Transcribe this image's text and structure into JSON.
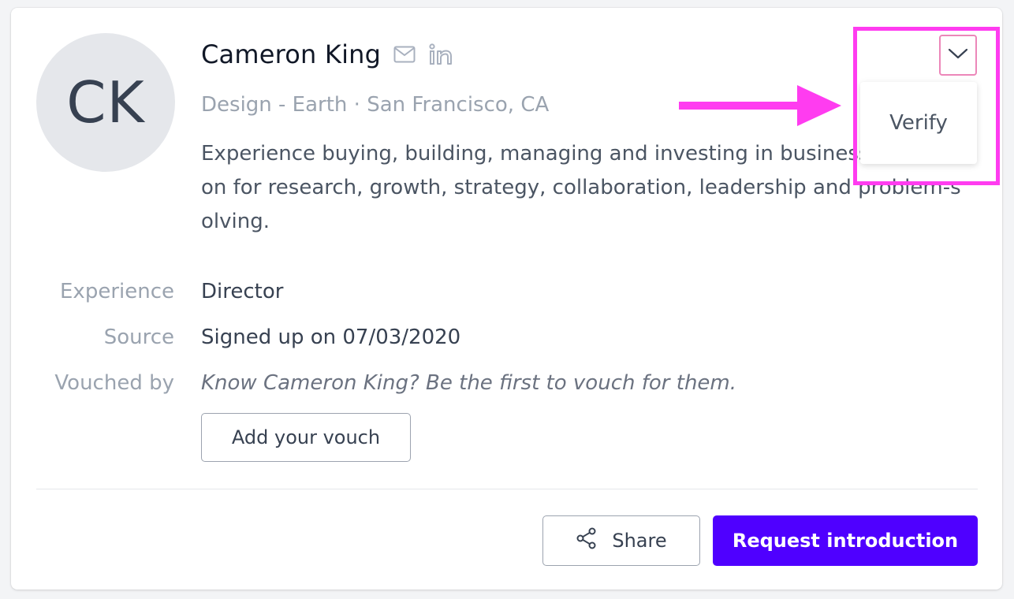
{
  "profile": {
    "initials": "CK",
    "name": "Cameron King",
    "subtitle": "Design - Earth · San Francisco, CA",
    "bio": "Experience buying, building, managing and investing in businesses. Passion for research, growth, strategy, collaboration, leadership and problem-solving."
  },
  "icons": {
    "email": "mail-icon",
    "linkedin": "linkedin-icon",
    "share": "share-icon",
    "toggle": "chevron-down-icon"
  },
  "details": [
    {
      "label": "Experience",
      "value": "Director"
    },
    {
      "label": "Source",
      "value": "Signed up on 07/03/2020"
    },
    {
      "label": "Vouched by",
      "value": "Know Cameron King? Be the first to vouch for them."
    }
  ],
  "buttons": {
    "add_vouch": "Add your vouch",
    "share": "Share",
    "request_intro": "Request introduction"
  },
  "menu": {
    "items": [
      "Verify"
    ]
  },
  "colors": {
    "primary": "#4f00ff",
    "annotation": "#ff3cf0",
    "avatar_bg": "#e5e7eb"
  }
}
